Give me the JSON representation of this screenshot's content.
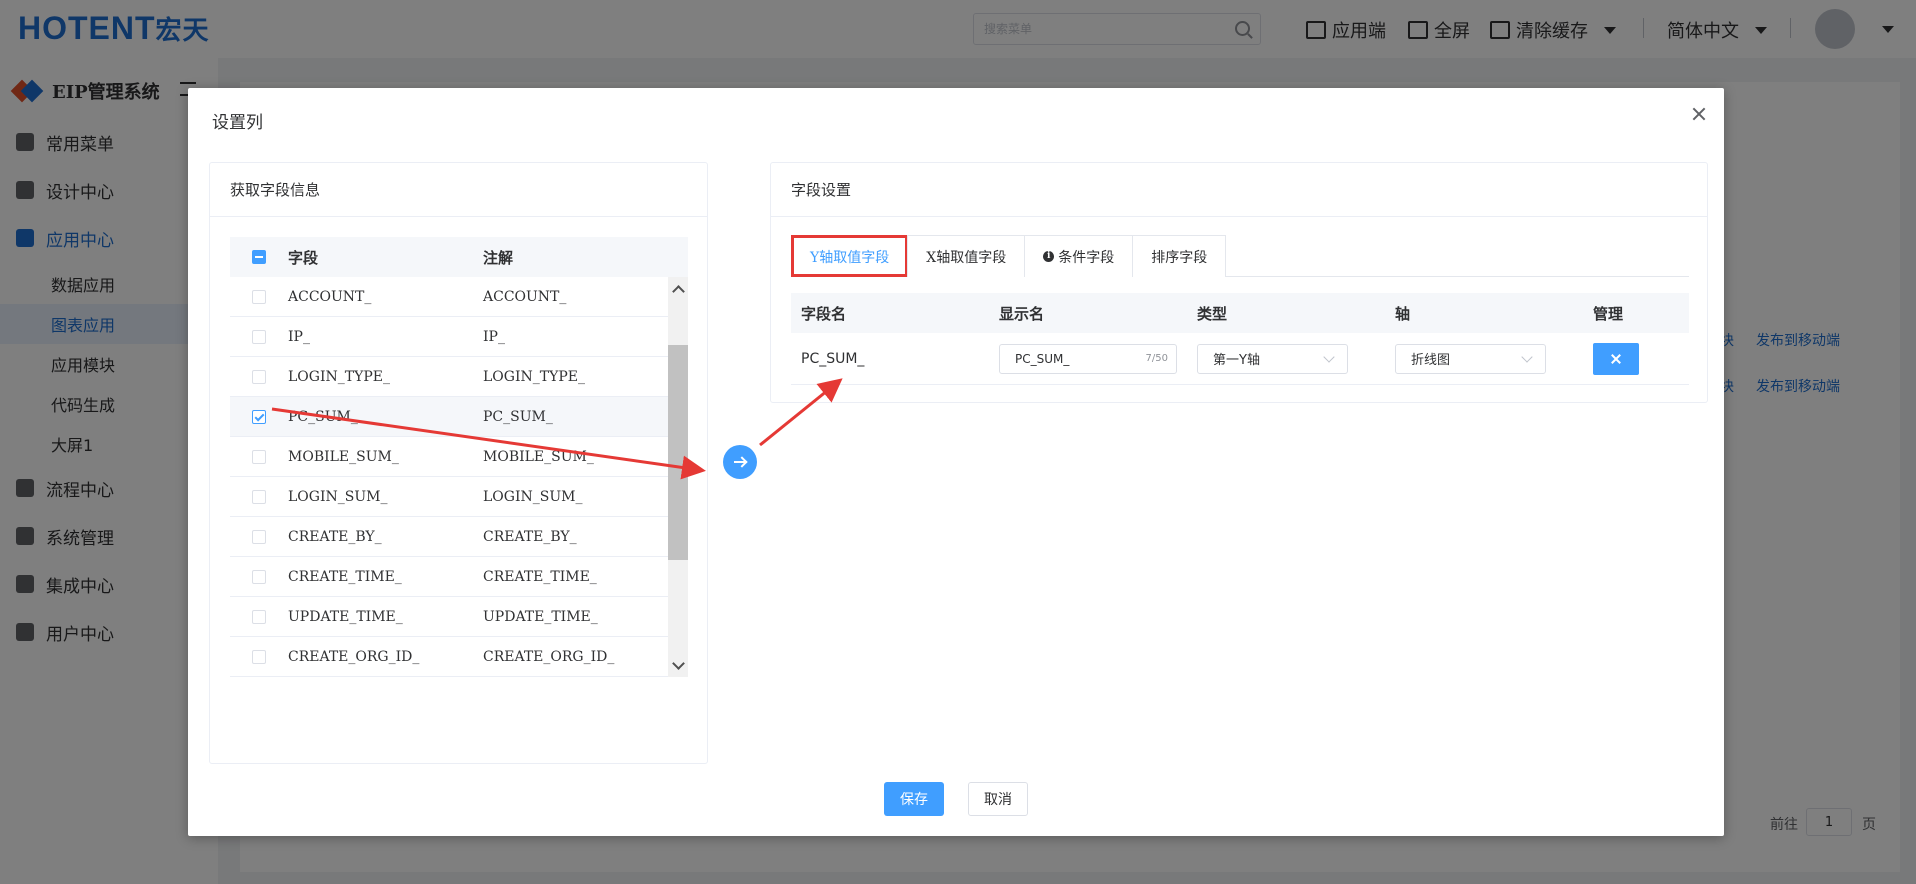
{
  "app": {
    "logo_text": "HOTENT",
    "logo_cn": "宏天",
    "brand": "EIP管理系统",
    "search_placeholder": "搜索菜单",
    "toolbar": {
      "app_end": "应用端",
      "fullscreen": "全屏",
      "clear_cache": "清除缓存",
      "language": "简体中文"
    },
    "sidebar": {
      "items": [
        {
          "label": "常用菜单"
        },
        {
          "label": "设计中心"
        },
        {
          "label": "应用中心"
        },
        {
          "label": "流程中心"
        },
        {
          "label": "系统管理"
        },
        {
          "label": "集成中心"
        },
        {
          "label": "用户中心"
        }
      ],
      "subitems": [
        {
          "label": "数据应用"
        },
        {
          "label": "图表应用"
        },
        {
          "label": "应用模块"
        },
        {
          "label": "代码生成"
        },
        {
          "label": "大屏1"
        }
      ]
    },
    "bg_links": {
      "block1": "块",
      "publish1": "发布到移动端",
      "block2": "块",
      "publish2": "发布到移动端",
      "goto": "前往",
      "page_value": "1",
      "page_unit": "页"
    }
  },
  "dialog": {
    "title": "设置列",
    "left_card": {
      "title": "获取字段信息",
      "columns": {
        "field": "字段",
        "note": "注解"
      },
      "rows": [
        {
          "field": "ACCOUNT_",
          "note": "ACCOUNT_",
          "checked": false
        },
        {
          "field": "IP_",
          "note": "IP_",
          "checked": false
        },
        {
          "field": "LOGIN_TYPE_",
          "note": "LOGIN_TYPE_",
          "checked": false
        },
        {
          "field": "PC_SUM_",
          "note": "PC_SUM_",
          "checked": true
        },
        {
          "field": "MOBILE_SUM_",
          "note": "MOBILE_SUM_",
          "checked": false
        },
        {
          "field": "LOGIN_SUM_",
          "note": "LOGIN_SUM_",
          "checked": false
        },
        {
          "field": "CREATE_BY_",
          "note": "CREATE_BY_",
          "checked": false
        },
        {
          "field": "CREATE_TIME_",
          "note": "CREATE_TIME_",
          "checked": false
        },
        {
          "field": "UPDATE_TIME_",
          "note": "UPDATE_TIME_",
          "checked": false
        },
        {
          "field": "CREATE_ORG_ID_",
          "note": "CREATE_ORG_ID_",
          "checked": false
        }
      ]
    },
    "right_card": {
      "title": "字段设置",
      "tabs": [
        {
          "label": "Y轴取值字段",
          "active": true
        },
        {
          "label": "X轴取值字段",
          "active": false
        },
        {
          "label": "条件字段",
          "active": false,
          "icon": "info-icon"
        },
        {
          "label": "排序字段",
          "active": false
        }
      ],
      "columns": {
        "name": "字段名",
        "display": "显示名",
        "type": "类型",
        "axis": "轴",
        "manage": "管理"
      },
      "rows": [
        {
          "name": "PC_SUM_",
          "display": "PC_SUM_",
          "display_count": "7/50",
          "type": "第一Y轴",
          "axis": "折线图"
        }
      ]
    },
    "save_label": "保存",
    "cancel_label": "取消"
  },
  "colors": {
    "primary": "#409eff",
    "annotation_red": "#e53935"
  }
}
